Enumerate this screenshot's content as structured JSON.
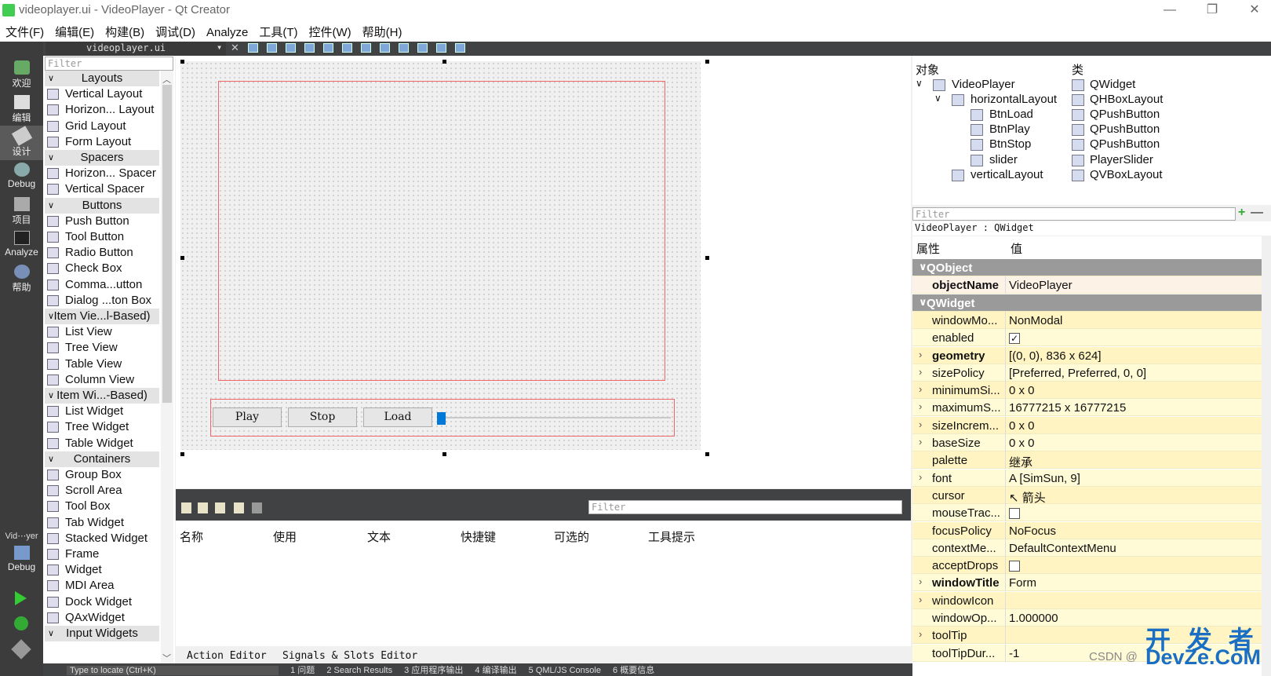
{
  "window": {
    "title": "videoplayer.ui - VideoPlayer - Qt Creator"
  },
  "menu": [
    "文件(F)",
    "编辑(E)",
    "构建(B)",
    "调试(D)",
    "Analyze",
    "工具(T)",
    "控件(W)",
    "帮助(H)"
  ],
  "modes": [
    {
      "label": "欢迎",
      "icon": "qt-logo-icon"
    },
    {
      "label": "编辑",
      "icon": "edit-doc-icon"
    },
    {
      "label": "设计",
      "icon": "design-pen-icon"
    },
    {
      "label": "Debug",
      "icon": "bug-icon"
    },
    {
      "label": "项目",
      "icon": "project-wrench-icon"
    },
    {
      "label": "Analyze",
      "icon": "analyze-monitor-icon"
    },
    {
      "label": "帮助",
      "icon": "help-icon"
    }
  ],
  "target": {
    "name": "Vid⋯yer",
    "mode": "Debug"
  },
  "file_combo": "videoplayer.ui",
  "widget_box": {
    "filter_placeholder": "Filter",
    "categories": [
      {
        "name": "Layouts",
        "items": [
          "Vertical Layout",
          "Horizon... Layout",
          "Grid Layout",
          "Form Layout"
        ]
      },
      {
        "name": "Spacers",
        "items": [
          "Horizon... Spacer",
          "Vertical Spacer"
        ]
      },
      {
        "name": "Buttons",
        "items": [
          "Push Button",
          "Tool Button",
          "Radio Button",
          "Check Box",
          "Comma...utton",
          "Dialog ...ton Box"
        ]
      },
      {
        "name": "Item Vie...l-Based)",
        "items": [
          "List View",
          "Tree View",
          "Table View",
          "Column View"
        ]
      },
      {
        "name": "Item Wi...-Based)",
        "items": [
          "List Widget",
          "Tree Widget",
          "Table Widget"
        ]
      },
      {
        "name": "Containers",
        "items": [
          "Group Box",
          "Scroll Area",
          "Tool Box",
          "Tab Widget",
          "Stacked Widget",
          "Frame",
          "Widget",
          "MDI Area",
          "Dock Widget",
          "QAxWidget"
        ]
      },
      {
        "name": "Input Widgets",
        "items": []
      }
    ]
  },
  "form": {
    "buttons": [
      "Play",
      "Stop",
      "Load"
    ]
  },
  "action_editor": {
    "filter_placeholder": "Filter",
    "columns": [
      "名称",
      "使用",
      "文本",
      "快捷键",
      "可选的",
      "工具提示"
    ],
    "tabs": [
      "Action Editor",
      "Signals & Slots Editor"
    ]
  },
  "status": {
    "locator": "Type to locate (Ctrl+K)",
    "panes": [
      "1 问题",
      "2 Search Results",
      "3 应用程序输出",
      "4 编译输出",
      "5 QML/JS Console",
      "6 概要信息"
    ]
  },
  "object_inspector": {
    "headers": [
      "对象",
      "类"
    ],
    "rows": [
      {
        "name": "VideoPlayer",
        "cls": "QWidget",
        "depth": 0,
        "expanded": true
      },
      {
        "name": "horizontalLayout",
        "cls": "QHBoxLayout",
        "depth": 1,
        "expanded": true
      },
      {
        "name": "BtnLoad",
        "cls": "QPushButton",
        "depth": 2
      },
      {
        "name": "BtnPlay",
        "cls": "QPushButton",
        "depth": 2
      },
      {
        "name": "BtnStop",
        "cls": "QPushButton",
        "depth": 2
      },
      {
        "name": "slider",
        "cls": "PlayerSlider",
        "depth": 2
      },
      {
        "name": "verticalLayout",
        "cls": "QVBoxLayout",
        "depth": 1
      }
    ]
  },
  "property_editor": {
    "filter_placeholder": "Filter",
    "class_line": "VideoPlayer : QWidget",
    "headers": [
      "属性",
      "值"
    ],
    "rows": [
      {
        "type": "header",
        "name": "QObject"
      },
      {
        "name": "objectName",
        "value": "VideoPlayer",
        "bold": true,
        "obj": true
      },
      {
        "type": "header",
        "name": "QWidget"
      },
      {
        "name": "windowMo...",
        "value": "NonModal"
      },
      {
        "name": "enabled",
        "value": "",
        "checkbox": true,
        "checked": true
      },
      {
        "name": "geometry",
        "value": "[(0, 0), 836 x 624]",
        "bold": true,
        "expandable": true
      },
      {
        "name": "sizePolicy",
        "value": "[Preferred, Preferred, 0, 0]",
        "expandable": true
      },
      {
        "name": "minimumSi...",
        "value": "0 x 0",
        "expandable": true
      },
      {
        "name": "maximumS...",
        "value": "16777215 x 16777215",
        "expandable": true
      },
      {
        "name": "sizeIncrem...",
        "value": "0 x 0",
        "expandable": true
      },
      {
        "name": "baseSize",
        "value": "0 x 0",
        "expandable": true
      },
      {
        "name": "palette",
        "value": "继承"
      },
      {
        "name": "font",
        "value": "A  [SimSun, 9]",
        "expandable": true
      },
      {
        "name": "cursor",
        "value": "↖ 箭头"
      },
      {
        "name": "mouseTrac...",
        "value": "",
        "checkbox": true,
        "checked": false
      },
      {
        "name": "focusPolicy",
        "value": "NoFocus"
      },
      {
        "name": "contextMe...",
        "value": "DefaultContextMenu"
      },
      {
        "name": "acceptDrops",
        "value": "",
        "checkbox": true,
        "checked": false
      },
      {
        "name": "windowTitle",
        "value": "Form",
        "bold": true,
        "expandable": true
      },
      {
        "name": "windowIcon",
        "value": "",
        "expandable": true
      },
      {
        "name": "windowOp...",
        "value": "1.000000"
      },
      {
        "name": "toolTip",
        "value": "",
        "expandable": true
      },
      {
        "name": "toolTipDur...",
        "value": "-1"
      }
    ]
  },
  "watermark": {
    "big": "开 发 者",
    "small": "CSDN @",
    "site": "DevZe.CoM"
  }
}
